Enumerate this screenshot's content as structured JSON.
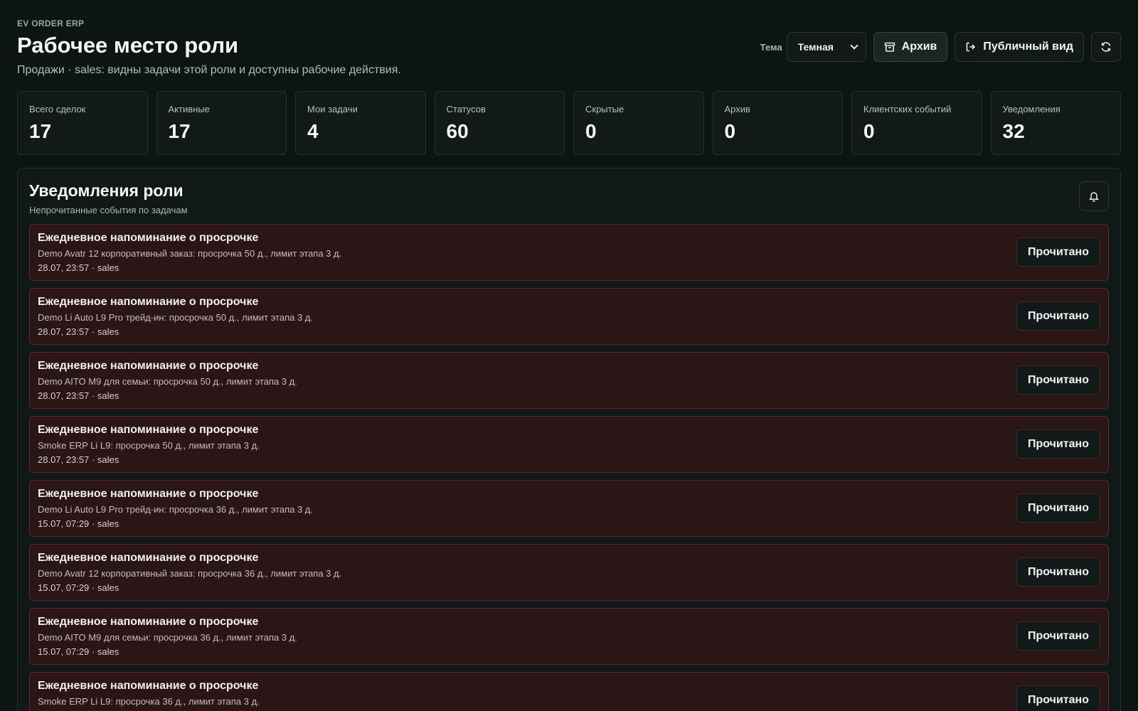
{
  "header": {
    "brand": "EV ORDER ERP",
    "title": "Рабочее место роли",
    "subtitle": "Продажи · sales: видны задачи этой роли и доступны рабочие действия.",
    "theme_label": "Тема",
    "theme_value": "Темная",
    "archive_label": "Архив",
    "public_view_label": "Публичный вид"
  },
  "stats": [
    {
      "label": "Всего сделок",
      "value": "17"
    },
    {
      "label": "Активные",
      "value": "17"
    },
    {
      "label": "Мои задачи",
      "value": "4"
    },
    {
      "label": "Статусов",
      "value": "60"
    },
    {
      "label": "Скрытые",
      "value": "0"
    },
    {
      "label": "Архив",
      "value": "0"
    },
    {
      "label": "Клиентских событий",
      "value": "0"
    },
    {
      "label": "Уведомления",
      "value": "32"
    }
  ],
  "notifications_panel": {
    "title": "Уведомления роли",
    "subtitle": "Непрочитанные события по задачам",
    "read_label": "Прочитано",
    "items": [
      {
        "title": "Ежедневное напоминание о просрочке",
        "text": "Demo Avatr 12 корпоративный заказ: просрочка 50 д., лимит этапа 3 д.",
        "meta": "28.07, 23:57 · sales"
      },
      {
        "title": "Ежедневное напоминание о просрочке",
        "text": "Demo Li Auto L9 Pro трейд-ин: просрочка 50 д., лимит этапа 3 д.",
        "meta": "28.07, 23:57 · sales"
      },
      {
        "title": "Ежедневное напоминание о просрочке",
        "text": "Demo AITO M9 для семьи: просрочка 50 д., лимит этапа 3 д.",
        "meta": "28.07, 23:57 · sales"
      },
      {
        "title": "Ежедневное напоминание о просрочке",
        "text": "Smoke ERP Li L9: просрочка 50 д., лимит этапа 3 д.",
        "meta": "28.07, 23:57 · sales"
      },
      {
        "title": "Ежедневное напоминание о просрочке",
        "text": "Demo Li Auto L9 Pro трейд-ин: просрочка 36 д., лимит этапа 3 д.",
        "meta": "15.07, 07:29 · sales"
      },
      {
        "title": "Ежедневное напоминание о просрочке",
        "text": "Demo Avatr 12 корпоративный заказ: просрочка 36 д., лимит этапа 3 д.",
        "meta": "15.07, 07:29 · sales"
      },
      {
        "title": "Ежедневное напоминание о просрочке",
        "text": "Demo AITO M9 для семьи: просрочка 36 д., лимит этапа 3 д.",
        "meta": "15.07, 07:29 · sales"
      },
      {
        "title": "Ежедневное напоминание о просрочке",
        "text": "Smoke ERP Li L9: просрочка 36 д., лимит этапа 3 д.",
        "meta": ""
      }
    ]
  }
}
